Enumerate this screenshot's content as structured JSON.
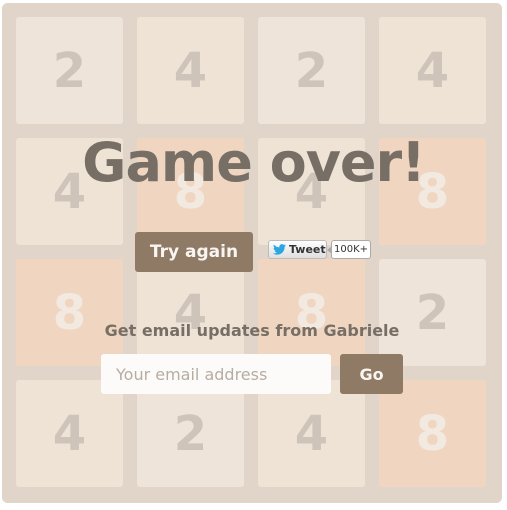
{
  "board": {
    "tiles": [
      [
        "2",
        "4",
        "2",
        "4"
      ],
      [
        "4",
        "8",
        "4",
        "8"
      ],
      [
        "8",
        "4",
        "8",
        "2"
      ],
      [
        "4",
        "2",
        "4",
        "8"
      ]
    ]
  },
  "overlay": {
    "title": "Game over!",
    "retry_label": "Try again",
    "tweet_label": "Tweet",
    "tweet_count": "100K+",
    "email_prompt": "Get email updates from Gabriele",
    "email_placeholder": "Your email address",
    "go_label": "Go"
  },
  "colors": {
    "board": "#bbada0",
    "tile_2": "#eee4da",
    "tile_4": "#ede0c8",
    "tile_8": "#f2b179",
    "button": "#8f7a66",
    "text": "#776e65"
  }
}
